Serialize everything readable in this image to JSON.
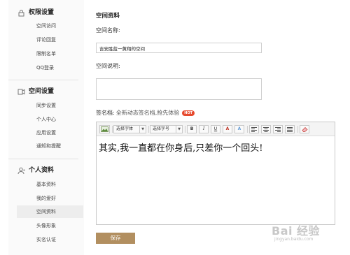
{
  "sidebar": {
    "sections": [
      {
        "title": "权限设置",
        "icon": "lock-icon",
        "items": [
          "空间访问",
          "评论回复",
          "限制名单",
          "QQ登录"
        ]
      },
      {
        "title": "空间设置",
        "icon": "space-icon",
        "items": [
          "同步设置",
          "个人中心",
          "应用设置",
          "通知和提醒"
        ]
      },
      {
        "title": "个人资料",
        "icon": "user-icon",
        "items": [
          "基本资料",
          "我的爱好",
          "空间资料",
          "头像形象",
          "实名认证"
        ]
      }
    ],
    "active_item": "空间资料"
  },
  "main": {
    "title": "空间资料",
    "name_label": "空间名称:",
    "name_value": "吉安胜蓝一黄翔的空间",
    "desc_label": "空间说明:",
    "signature": {
      "label": "签名档:",
      "promo": "全新动态签名档,抢先体验",
      "badge": "HOT"
    },
    "editor": {
      "toolbar": {
        "font_select": "选择字体",
        "size_select": "选择字号",
        "bold": "B",
        "italic": "I",
        "underline": "U",
        "font_color": "A",
        "font_shadow": "A"
      },
      "content": "其实,我一直都在你身后,只差你一个回头!"
    },
    "save_label": "保存"
  },
  "watermark": {
    "main": "Bai 经验",
    "sub": "jingyan.baidu.com"
  },
  "colors": {
    "save_button": "#b28f60",
    "hot_badge": "#e64a2e",
    "active_item_bg": "#ededed"
  }
}
